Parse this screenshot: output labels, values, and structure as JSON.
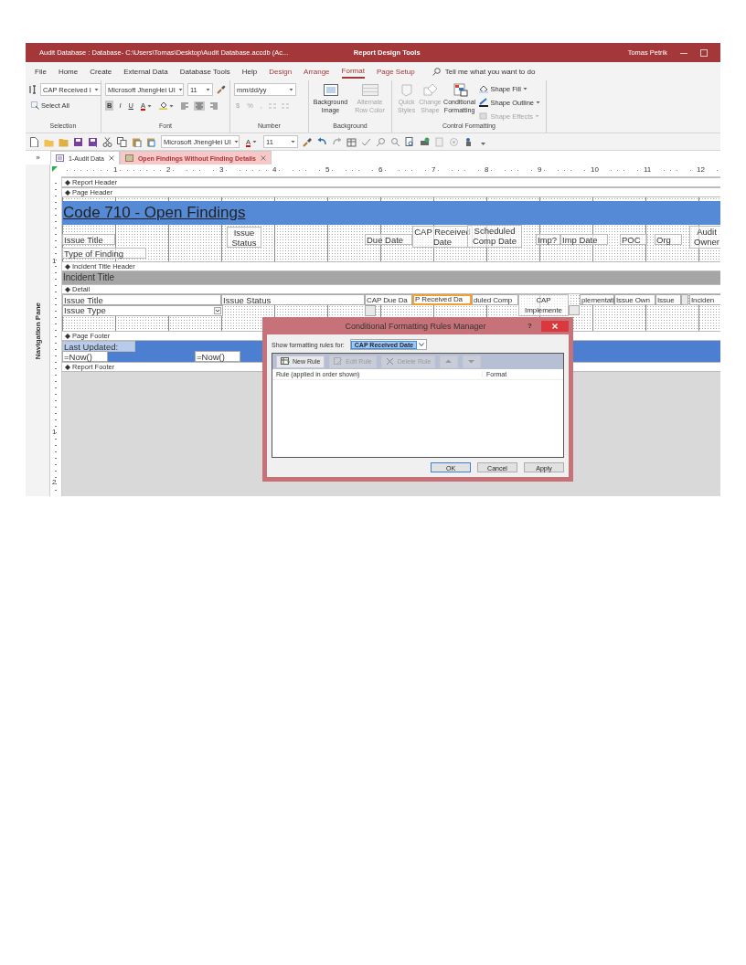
{
  "title_bar": {
    "title": "Audit Database : Database- C:\\Users\\Tomas\\Desktop\\Audit Database.accdb (Ac...",
    "context": "Report Design Tools",
    "user": "Tomas Petrik"
  },
  "menu_tabs": [
    {
      "label": "File",
      "selected": false,
      "contextual": false
    },
    {
      "label": "Home",
      "selected": false,
      "contextual": false
    },
    {
      "label": "Create",
      "selected": false,
      "contextual": false
    },
    {
      "label": "External Data",
      "selected": false,
      "contextual": false
    },
    {
      "label": "Database Tools",
      "selected": false,
      "contextual": false
    },
    {
      "label": "Help",
      "selected": false,
      "contextual": false
    },
    {
      "label": "Design",
      "selected": false,
      "contextual": true
    },
    {
      "label": "Arrange",
      "selected": false,
      "contextual": true
    },
    {
      "label": "Format",
      "selected": true,
      "contextual": true
    },
    {
      "label": "Page Setup",
      "selected": false,
      "contextual": true
    }
  ],
  "tell_me": "Tell me what you want to do",
  "ribbon": {
    "selection": {
      "label": "Selection",
      "object": "CAP Received I",
      "select_all": "Select All"
    },
    "font": {
      "label": "Font",
      "font": "Microsoft JhengHei UI",
      "size": "11",
      "font_color": "A",
      "styles": [
        {
          "label": "B",
          "selected": true
        },
        {
          "label": "I",
          "selected": false
        },
        {
          "label": "U",
          "selected": false
        }
      ],
      "align": [
        {
          "selected": false
        },
        {
          "selected": true
        },
        {
          "selected": false
        }
      ]
    },
    "number": {
      "label": "Number",
      "format": "mm/dd/yy",
      "buttons": [
        {
          "label": "$",
          "disabled": true
        },
        {
          "label": "%",
          "disabled": true
        },
        {
          "label": ",",
          "disabled": true
        }
      ]
    },
    "background": {
      "label": "Background",
      "buttons": [
        {
          "label": "Background Image",
          "disabled": false
        },
        {
          "label": "Alternate Row Color",
          "disabled": true
        }
      ]
    },
    "control_formatting": {
      "label": "Control Formatting",
      "buttons": [
        {
          "label": "Quick Styles",
          "disabled": true
        },
        {
          "label": "Change Shape",
          "disabled": true
        },
        {
          "label": "Conditional Formatting",
          "disabled": false
        }
      ],
      "shape_buttons": [
        {
          "label": "Shape Fill",
          "disabled": false
        },
        {
          "label": "Shape Outline",
          "disabled": false
        },
        {
          "label": "Shape Effects",
          "disabled": true
        }
      ]
    }
  },
  "quick_access": {
    "font": "Microsoft JhengHei UI",
    "font_color": "A",
    "size": "11"
  },
  "expand_label": "»",
  "document_tabs": [
    {
      "label": "1-Audit Data",
      "selected": false
    },
    {
      "label": "Open Findings Without Finding Details",
      "selected": true
    }
  ],
  "navigation_pane": "Navigation Pane",
  "horizontal_ruler": [
    "1",
    "2",
    "3",
    "4",
    "5",
    "6",
    "7",
    "8",
    "9",
    "10",
    "11",
    "12"
  ],
  "vertical_ruler": [
    "1",
    "1",
    "2"
  ],
  "sections": [
    {
      "label": "Report Header"
    },
    {
      "label": "Page Header",
      "controls": [
        {
          "kind": "title",
          "text": "Code 710 - Open Findings",
          "selected": false
        },
        {
          "kind": "label",
          "text": "Issue Title",
          "selected": false
        },
        {
          "kind": "label",
          "text": "Issue Status",
          "selected": false
        },
        {
          "kind": "label",
          "text": "Type of Finding",
          "selected": false
        },
        {
          "kind": "label",
          "text": "Due Date",
          "selected": false
        },
        {
          "kind": "label",
          "text": "CAP Received Date",
          "selected": false
        },
        {
          "kind": "label",
          "text": "Scheduled Comp Date",
          "selected": false
        },
        {
          "kind": "label",
          "text": "Imp?",
          "selected": false
        },
        {
          "kind": "label",
          "text": "Imp Date",
          "selected": false
        },
        {
          "kind": "label",
          "text": "POC",
          "selected": false
        },
        {
          "kind": "label",
          "text": "Org",
          "selected": false
        },
        {
          "kind": "label",
          "text": "Audit Owner",
          "selected": false
        }
      ]
    },
    {
      "label": "Incident Title Header",
      "controls": [
        {
          "kind": "band",
          "text": "Incident Title",
          "selected": false
        }
      ]
    },
    {
      "label": "Detail",
      "controls": [
        {
          "kind": "textbox",
          "text": "Issue Title",
          "selected": false
        },
        {
          "kind": "combo",
          "text": "Issue Type",
          "selected": false
        },
        {
          "kind": "textbox",
          "text": "Issue Status",
          "selected": false
        },
        {
          "kind": "textbox",
          "text": "CAP Due Da",
          "selected": false
        },
        {
          "kind": "textbox",
          "text": "P Received Da",
          "selected": true
        },
        {
          "kind": "textbox",
          "text": "duled Comp",
          "selected": false
        },
        {
          "kind": "label",
          "text": "CAP Implemente",
          "selected": false
        },
        {
          "kind": "textbox",
          "text": "plementati",
          "selected": false
        },
        {
          "kind": "textbox",
          "text": "Issue Own",
          "selected": false
        },
        {
          "kind": "textbox",
          "text": "Issue",
          "selected": false
        },
        {
          "kind": "textbox",
          "text": "Inciden",
          "selected": false
        },
        {
          "kind": "checkbox",
          "selected": false
        },
        {
          "kind": "checkbox",
          "selected": false
        },
        {
          "kind": "checkbox",
          "selected": false
        }
      ]
    },
    {
      "label": "Page Footer",
      "controls": [
        {
          "kind": "rectangle",
          "selected": false
        },
        {
          "kind": "label",
          "text": "Last Updated:",
          "selected": false
        },
        {
          "kind": "textbox",
          "text": "=Now()",
          "selected": false
        },
        {
          "kind": "textbox",
          "text": "=Now()",
          "selected": false
        }
      ]
    },
    {
      "label": "Report Footer"
    }
  ],
  "dialog": {
    "title": "Conditional Formatting Rules Manager",
    "help": "?",
    "show_label": "Show formatting rules for:",
    "show_value": "CAP Received Date",
    "toolbar": [
      {
        "kind": "new",
        "label": "New Rule",
        "disabled": false
      },
      {
        "kind": "edit",
        "label": "Edit Rule",
        "disabled": true
      },
      {
        "kind": "delete",
        "label": "Delete Rule",
        "disabled": true
      },
      {
        "kind": "up",
        "disabled": true
      },
      {
        "kind": "down",
        "disabled": true
      }
    ],
    "columns": [
      "Rule (applied in order shown)",
      "Format"
    ],
    "buttons": [
      {
        "label": "OK",
        "default": true
      },
      {
        "label": "Cancel",
        "default": false
      },
      {
        "label": "Apply",
        "default": false
      }
    ]
  }
}
